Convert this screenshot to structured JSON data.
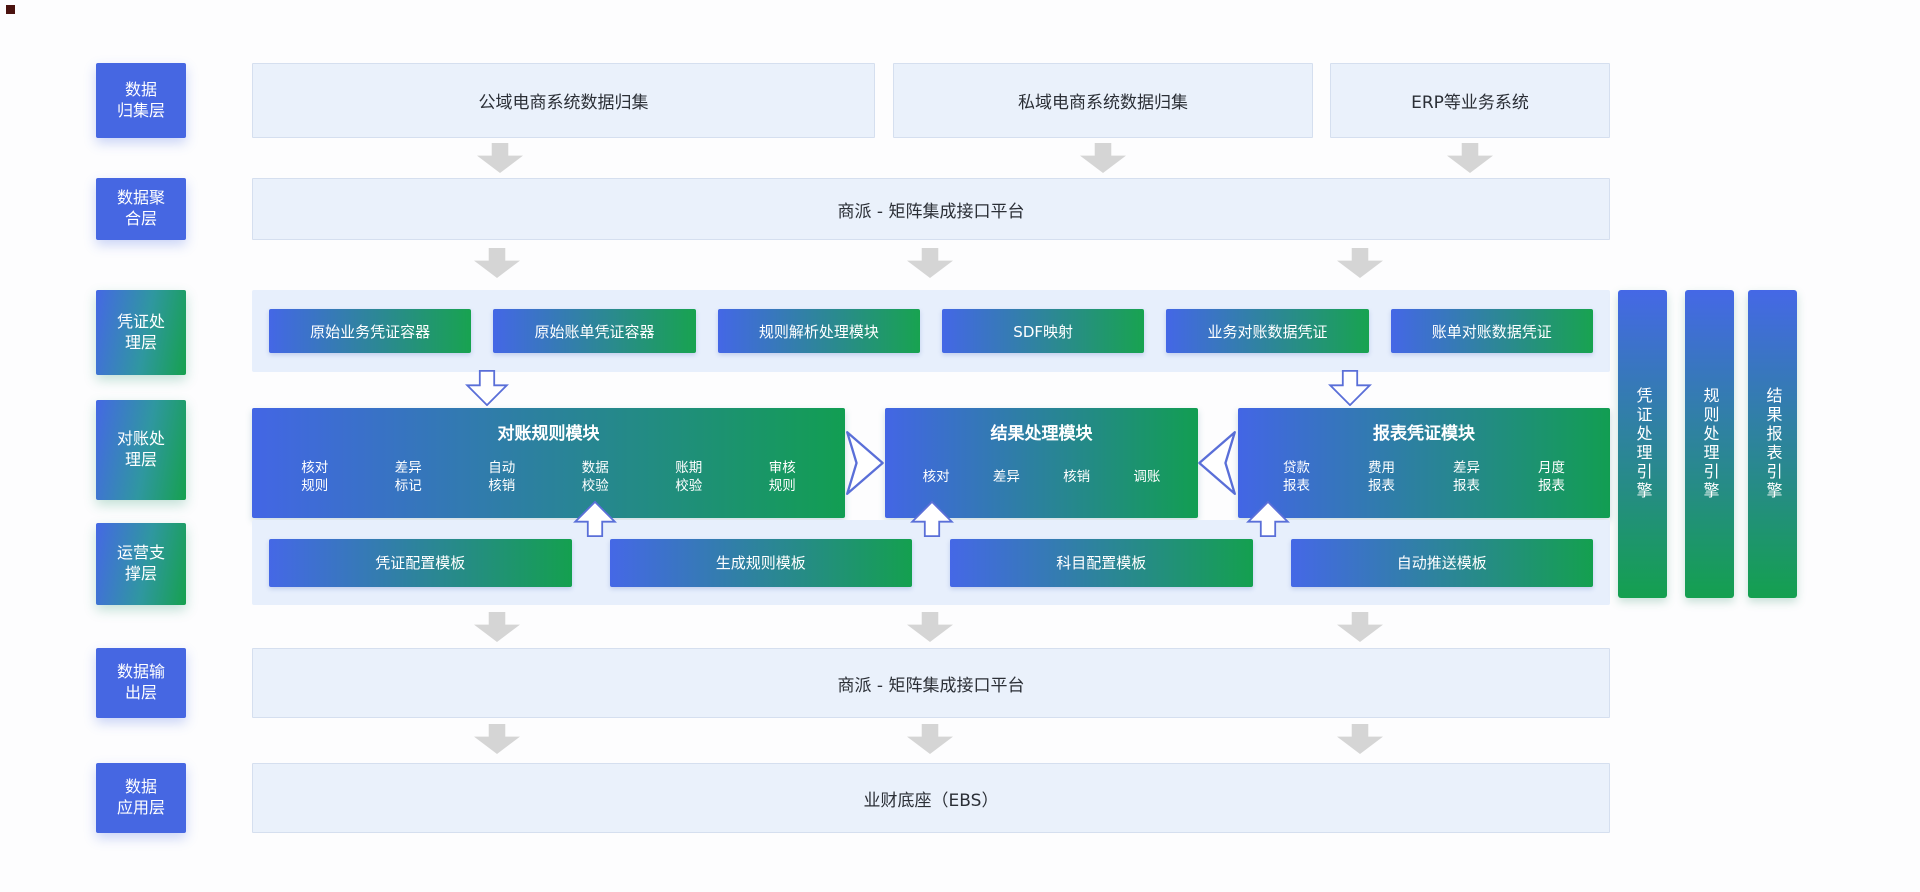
{
  "palette": {
    "solid_blue": "#4667e2",
    "gradient_blue": "#4467e6",
    "gradient_green": "#16a14e",
    "light_row_bg": "#eaf1fb",
    "light_row_border": "#d5dfef",
    "container_bg": "#e7effc",
    "gray_arrow": "#d5d5d5",
    "hollow_arrow_stroke": "#5a6fd8",
    "text_dark": "#2b2f36",
    "text_light": "#ffffff"
  },
  "side_layers": [
    {
      "label": "数据\n归集层",
      "style": "blue"
    },
    {
      "label": "数据聚\n合层",
      "style": "blue"
    },
    {
      "label": "凭证处\n理层",
      "style": "gradient"
    },
    {
      "label": "对账处\n理层",
      "style": "gradient"
    },
    {
      "label": "运营支\n撑层",
      "style": "gradient"
    },
    {
      "label": "数据输\n出层",
      "style": "blue"
    },
    {
      "label": "数据\n应用层",
      "style": "blue"
    }
  ],
  "collection_row": {
    "items": [
      "公域电商系统数据归集",
      "私域电商系统数据归集",
      "ERP等业务系统"
    ]
  },
  "aggregation_row": {
    "label": "商派 - 矩阵集成接口平台"
  },
  "voucher_row": {
    "items": [
      "原始业务凭证容器",
      "原始账单凭证容器",
      "规则解析处理模块",
      "SDF映射",
      "业务对账数据凭证",
      "账单对账数据凭证"
    ]
  },
  "reconciliation_row": {
    "rule_module": {
      "title": "对账规则模块",
      "items": [
        "核对\n规则",
        "差异\n标记",
        "自动\n核销",
        "数据\n校验",
        "账期\n校验",
        "审核\n规则"
      ]
    },
    "result_module": {
      "title": "结果处理模块",
      "items": [
        "核对",
        "差异",
        "核销",
        "调账"
      ]
    },
    "report_module": {
      "title": "报表凭证模块",
      "items": [
        "贷款\n报表",
        "费用\n报表",
        "差异\n报表",
        "月度\n报表"
      ]
    }
  },
  "support_row": {
    "items": [
      "凭证配置模板",
      "生成规则模板",
      "科目配置模板",
      "自动推送模板"
    ]
  },
  "output_row": {
    "label": "商派 - 矩阵集成接口平台"
  },
  "application_row": {
    "label": "业财底座（EBS）"
  },
  "engines": [
    {
      "label": "凭证处理引擎"
    },
    {
      "label": "规则处理引擎"
    },
    {
      "label": "结果报表引擎"
    }
  ]
}
